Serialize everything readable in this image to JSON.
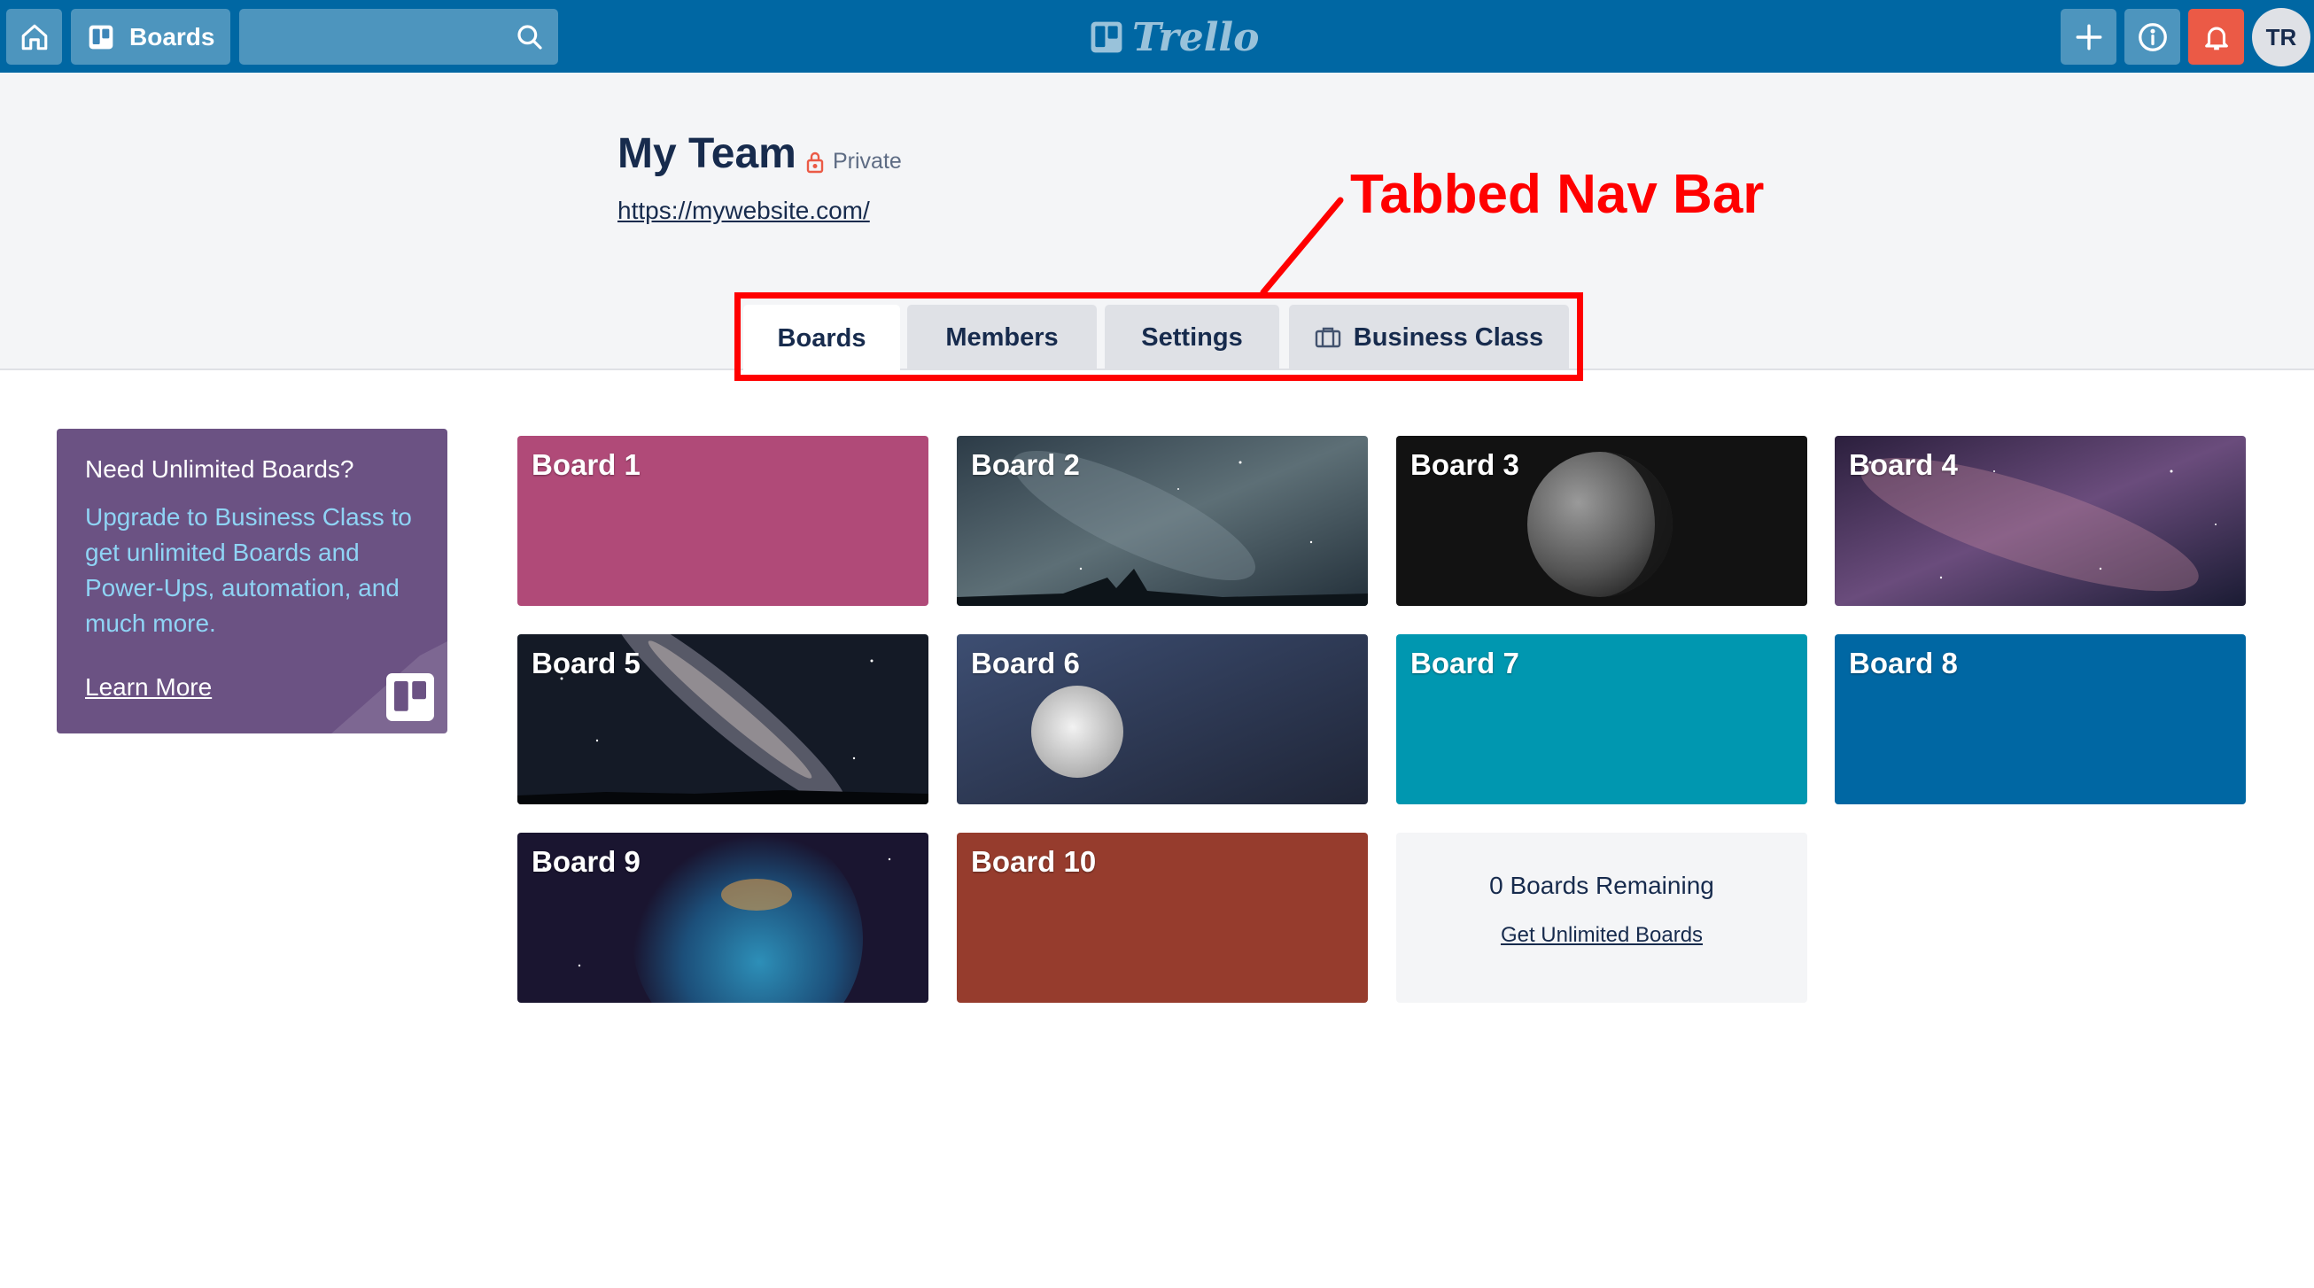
{
  "topbar": {
    "home_icon": "home-icon",
    "boards_label": "Boards",
    "search_value": "",
    "search_icon": "search-icon",
    "logo_text": "Trello",
    "avatar_initials": "TR"
  },
  "team": {
    "name": "My Team",
    "privacy": "Private",
    "url": "https://mywebsite.com/"
  },
  "tabs": [
    {
      "label": "Boards",
      "active": true
    },
    {
      "label": "Members",
      "active": false
    },
    {
      "label": "Settings",
      "active": false
    },
    {
      "label": "Business Class",
      "active": false,
      "icon": "briefcase-icon"
    }
  ],
  "annotation": {
    "label": "Tabbed Nav Bar",
    "color": "#ff0000"
  },
  "promo": {
    "title": "Need Unlimited Boards?",
    "description": "Upgrade to Business Class to get unlimited Boards and Power-Ups, automation, and much more.",
    "link": "Learn More"
  },
  "boards": [
    {
      "title": "Board 1",
      "background": "#b04a78"
    },
    {
      "title": "Board 2",
      "background": "night-sky-image"
    },
    {
      "title": "Board 3",
      "background": "moon-image"
    },
    {
      "title": "Board 4",
      "background": "galaxy-image"
    },
    {
      "title": "Board 5",
      "background": "milky-way-image"
    },
    {
      "title": "Board 6",
      "background": "moon-dusk-image"
    },
    {
      "title": "Board 7",
      "background": "#0097b0"
    },
    {
      "title": "Board 8",
      "background": "#0067a3"
    },
    {
      "title": "Board 9",
      "background": "nebula-image"
    },
    {
      "title": "Board 10",
      "background": "#963c2d"
    }
  ],
  "remaining": {
    "count_text": "0 Boards Remaining",
    "link": "Get Unlimited Boards"
  },
  "colors": {
    "topbar": "#0067a3",
    "notification": "#eb5a46",
    "promo": "#6b5283",
    "promo_text": "#8fd4f5"
  }
}
